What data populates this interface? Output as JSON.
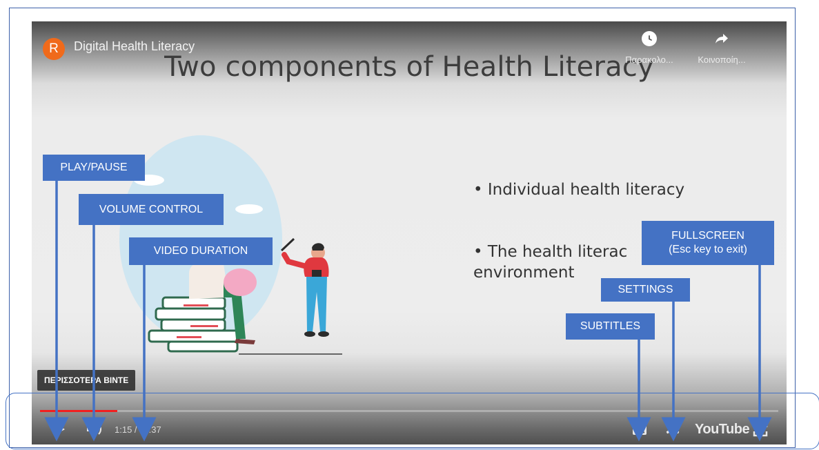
{
  "player": {
    "channel_avatar_letter": "R",
    "video_title": "Digital Health Literacy",
    "watch_later_label": "Παρακολο...",
    "share_label": "Κοινοποίη...",
    "slide": {
      "title": "Two components of Health Literacy",
      "bullets": [
        "• Individual health literacy",
        "• The health literac environment"
      ]
    },
    "more_videos_label": "ΠΕΡΙΣΣΟΤΕΡΑ ΒΙΝΤΕ",
    "time_display": "1:15 / 11:37",
    "progress_fraction": 0.105,
    "youtube_logo_text": "YouTube",
    "accent_color": "#f21f1f"
  },
  "annotations": {
    "color": "#4472c4",
    "play_pause": "PLAY/PAUSE",
    "volume_control": "VOLUME CONTROL",
    "video_duration": "VIDEO DURATION",
    "fullscreen_line1": "FULLSCREEN",
    "fullscreen_line2": "(Esc key to exit)",
    "settings": "SETTINGS",
    "subtitles": "SUBTITLES"
  }
}
